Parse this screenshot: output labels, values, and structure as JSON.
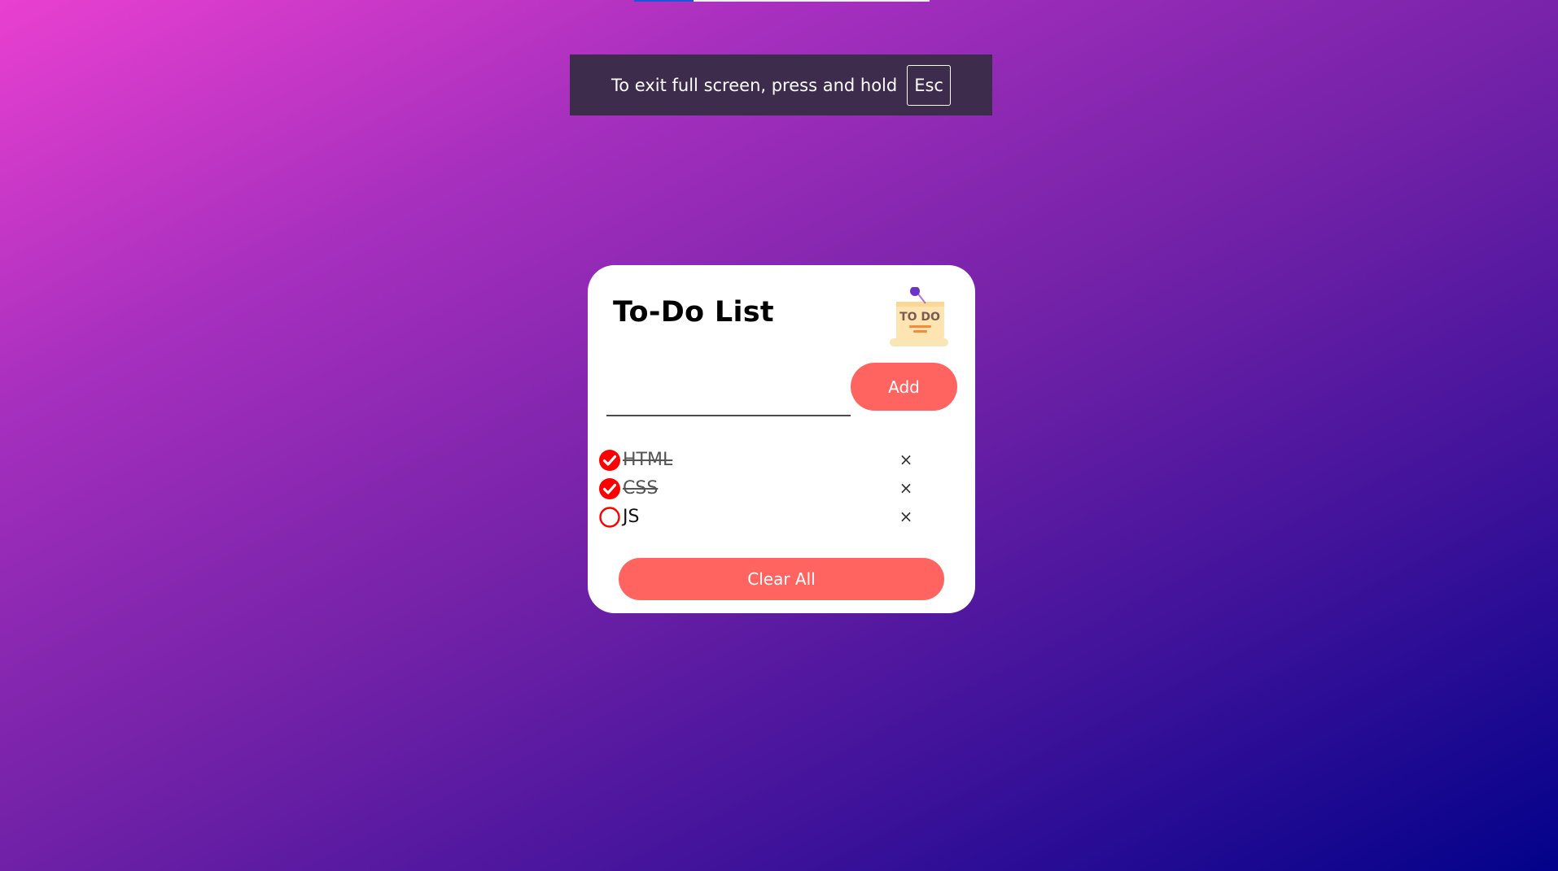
{
  "browser": {
    "loading_progress": 0.2
  },
  "fullscreen_notice": {
    "message": "To exit full screen, press and hold",
    "key": "Esc"
  },
  "app": {
    "title": "To-Do List",
    "logo_text": "TO DO",
    "input": {
      "value": "",
      "placeholder": ""
    },
    "add_label": "Add",
    "tasks": [
      {
        "label": "HTML",
        "done": true
      },
      {
        "label": "CSS",
        "done": true
      },
      {
        "label": "JS",
        "done": false
      }
    ],
    "remove_glyph": "×",
    "clear_label": "Clear All",
    "colors": {
      "accent": "#ff6461",
      "check": "#ff0000"
    }
  }
}
